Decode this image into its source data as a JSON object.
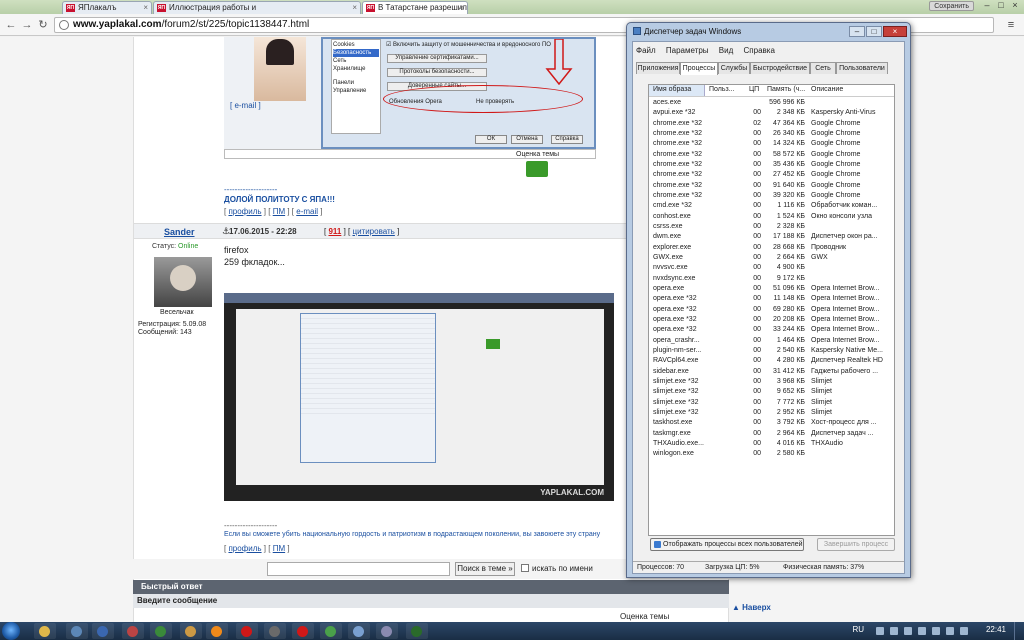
{
  "browser": {
    "tabs": [
      {
        "label": "ЯПлакалъ",
        "favicon": "ЯП"
      },
      {
        "label": "Иллюстрация работы и",
        "favicon": "ЯП"
      },
      {
        "label": "В Татарстане разрешил",
        "favicon": "ЯП"
      }
    ],
    "signin": "Сохранить",
    "url_host": "www.yaplakal.com",
    "url_path": "/forum2/st/225/topic1138447.html"
  },
  "post1": {
    "email_link": "[ e-mail ]",
    "settings_items": [
      "Cookies",
      "Безопасность",
      "Сеть",
      "Хранилище",
      "Панели",
      "Управление"
    ],
    "fraud_check": "Включить защиту от мошенничества и вредоносного ПО",
    "cert_btn": "Управление сертификатами...",
    "proto_btn": "Протоколы безопасности...",
    "trusted_btn": "Доверенные сайты...",
    "update_label": "Обновления Opera",
    "update_value": "Не проверять",
    "ok": "ОК",
    "cancel": "Отмена",
    "help": "Справка",
    "rating": "Оценка темы",
    "separator": "--------------------",
    "motto": "ДОЛОЙ ПОЛИТОТУ С ЯПА!!!",
    "links": {
      "profile": "профиль",
      "pm": "ПМ",
      "email": "e-mail"
    }
  },
  "post2": {
    "username": "Sander",
    "date": "17.06.2015 - 22:28",
    "number": "911",
    "quote": "цитировать",
    "status_label": "Статус:",
    "status_value": "Online",
    "rank": "Весельчак",
    "reg": "Регистрация: 5.09.08",
    "messages": "Сообщений: 143",
    "line1": "firefox",
    "line2": "259 фкладок...",
    "shot_logo": "YAPLAKAL.COM",
    "signature": "Если вы сможете убить национальную гордость и патриотизм в подрастающем поколении, вы завоюете эту страну",
    "sig_separator": "--------------------"
  },
  "search": {
    "button": "Поиск в теме »",
    "by_name": "искать по имени"
  },
  "reply": {
    "title": "Быстрый ответ",
    "enter": "Введите сообщение",
    "rating": "Оценка темы",
    "up": "▲ Наверх"
  },
  "taskmgr": {
    "title": "Диспетчер задач Windows",
    "menu": [
      "Файл",
      "Параметры",
      "Вид",
      "Справка"
    ],
    "tabs": [
      "Приложения",
      "Процессы",
      "Службы",
      "Быстродействие",
      "Сеть",
      "Пользователи"
    ],
    "active_tab": "Процессы",
    "columns": [
      "Имя образа",
      "Польз...",
      "ЦП",
      "Память (ч...",
      "Описание"
    ],
    "rows": [
      [
        "aces.exe",
        "",
        "596 996 КБ",
        ""
      ],
      [
        "avpui.exe *32",
        "00",
        "2 348 КБ",
        "Kaspersky Anti-Virus"
      ],
      [
        "chrome.exe *32",
        "02",
        "47 364 КБ",
        "Google Chrome"
      ],
      [
        "chrome.exe *32",
        "00",
        "26 340 КБ",
        "Google Chrome"
      ],
      [
        "chrome.exe *32",
        "00",
        "14 324 КБ",
        "Google Chrome"
      ],
      [
        "chrome.exe *32",
        "00",
        "58 572 КБ",
        "Google Chrome"
      ],
      [
        "chrome.exe *32",
        "00",
        "35 436 КБ",
        "Google Chrome"
      ],
      [
        "chrome.exe *32",
        "00",
        "27 452 КБ",
        "Google Chrome"
      ],
      [
        "chrome.exe *32",
        "00",
        "91 640 КБ",
        "Google Chrome"
      ],
      [
        "chrome.exe *32",
        "00",
        "39 320 КБ",
        "Google Chrome"
      ],
      [
        "cmd.exe *32",
        "00",
        "1 116 КБ",
        "Обработчик коман..."
      ],
      [
        "conhost.exe",
        "00",
        "1 524 КБ",
        "Окно консоли узла"
      ],
      [
        "csrss.exe",
        "00",
        "2 328 КБ",
        ""
      ],
      [
        "dwm.exe",
        "00",
        "17 188 КБ",
        "Диспетчер окон ра..."
      ],
      [
        "explorer.exe",
        "00",
        "28 668 КБ",
        "Проводник"
      ],
      [
        "GWX.exe",
        "00",
        "2 664 КБ",
        "GWX"
      ],
      [
        "nvvsvc.exe",
        "00",
        "4 900 КБ",
        ""
      ],
      [
        "nvxdsync.exe",
        "00",
        "9 172 КБ",
        ""
      ],
      [
        "opera.exe",
        "00",
        "51 096 КБ",
        "Opera Internet Brow..."
      ],
      [
        "opera.exe *32",
        "00",
        "11 148 КБ",
        "Opera Internet Brow..."
      ],
      [
        "opera.exe *32",
        "00",
        "69 280 КБ",
        "Opera Internet Brow..."
      ],
      [
        "opera.exe *32",
        "00",
        "20 208 КБ",
        "Opera Internet Brow..."
      ],
      [
        "opera.exe *32",
        "00",
        "33 244 КБ",
        "Opera Internet Brow..."
      ],
      [
        "opera_crashr...",
        "00",
        "1 464 КБ",
        "Opera Internet Brow..."
      ],
      [
        "plugin-nm-ser...",
        "00",
        "2 540 КБ",
        "Kaspersky Native Me..."
      ],
      [
        "RAVCpl64.exe",
        "00",
        "4 280 КБ",
        "Диспетчер Realtek HD"
      ],
      [
        "sidebar.exe",
        "00",
        "31 412 КБ",
        "Гаджеты рабочего ..."
      ],
      [
        "slimjet.exe *32",
        "00",
        "3 968 КБ",
        "Slimjet"
      ],
      [
        "slimjet.exe *32",
        "00",
        "9 652 КБ",
        "Slimjet"
      ],
      [
        "slimjet.exe *32",
        "00",
        "7 772 КБ",
        "Slimjet"
      ],
      [
        "slimjet.exe *32",
        "00",
        "2 952 КБ",
        "Slimjet"
      ],
      [
        "taskhost.exe",
        "00",
        "3 792 КБ",
        "Хост-процесс для ..."
      ],
      [
        "taskmgr.exe",
        "00",
        "2 964 КБ",
        "Диспетчер задач ..."
      ],
      [
        "THXAudio.exe...",
        "00",
        "4 016 КБ",
        "THXAudio"
      ],
      [
        "winlogon.exe",
        "00",
        "2 580 КБ",
        ""
      ]
    ],
    "show_all": "Отображать процессы всех пользователей",
    "end_process": "Завершить процесс",
    "status_procs": "Процессов: 70",
    "status_cpu": "Загрузка ЦП: 5%",
    "status_mem": "Физическая память: 37%"
  },
  "taskbar": {
    "lang": "RU",
    "time": "22:41"
  }
}
